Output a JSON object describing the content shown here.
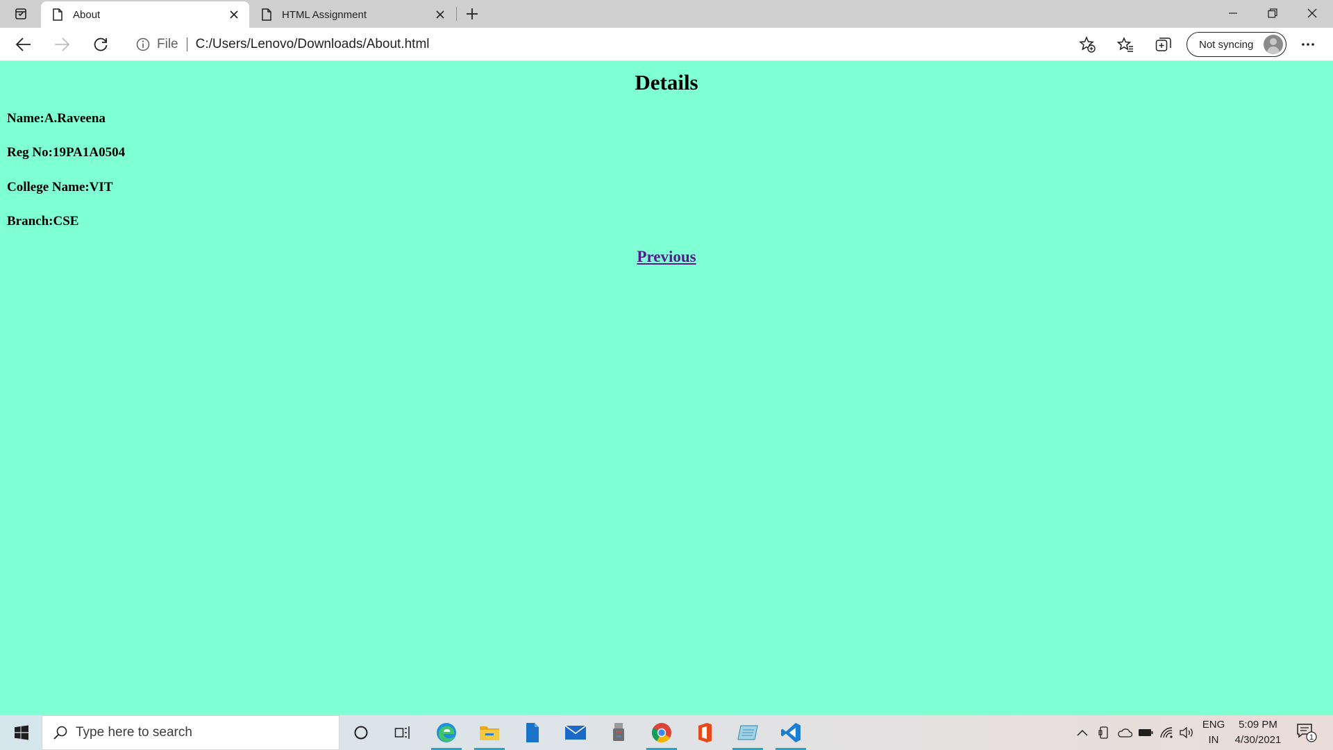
{
  "browser": {
    "tabs": [
      {
        "label": "About",
        "active": true
      },
      {
        "label": "HTML Assignment",
        "active": false
      }
    ],
    "address": {
      "scheme_label": "File",
      "url": "C:/Users/Lenovo/Downloads/About.html"
    },
    "profile": {
      "label": "Not syncing"
    }
  },
  "page": {
    "background_color": "#7fffd4",
    "heading": "Details",
    "details": [
      "Name:A.Raveena",
      "Reg No:19PA1A0504",
      "College Name:VIT",
      "Branch:CSE"
    ],
    "link_label": "Previous",
    "link_color": "#551a8b"
  },
  "taskbar": {
    "search_placeholder": "Type here to search",
    "apps": [
      "cortana-icon",
      "task-view-icon",
      "edge-icon",
      "file-explorer-icon",
      "files-icon",
      "mail-icon",
      "usb-icon",
      "chrome-icon",
      "office-icon",
      "notepad-icon",
      "vscode-icon"
    ],
    "language": {
      "top": "ENG",
      "bottom": "IN"
    },
    "clock": {
      "time": "5:09 PM",
      "date": "4/30/2021"
    },
    "notification_count": "1"
  }
}
